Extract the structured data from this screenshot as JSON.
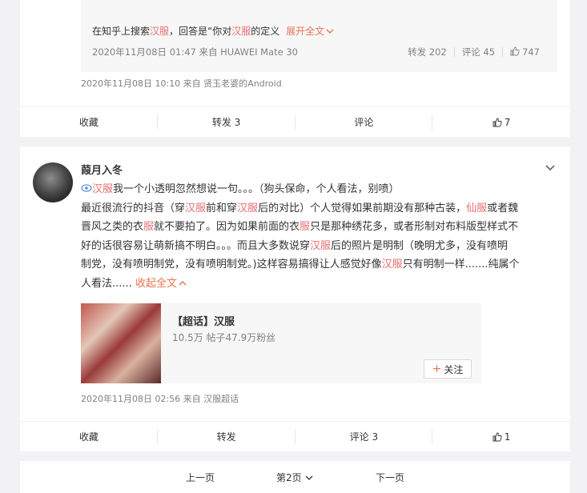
{
  "post1": {
    "quote": {
      "text_pre": "在知乎上搜索",
      "text_hl1": "汉服",
      "text_mid": "，回答是“你对",
      "text_hl2": "汉服",
      "text_post": "的定义",
      "expand": "展开全文",
      "meta": "2020年11月08日 01:47 来自 HUAWEI Mate 30",
      "repost": "转发 202",
      "comment": "评论 45",
      "likes": "747"
    },
    "meta": "2020年11月08日 10:10  来自 贤玉老婆的Android",
    "actions": {
      "collect": "收藏",
      "repost": "转发 3",
      "comment": "评论",
      "likes": "7"
    }
  },
  "post2": {
    "username": "葭月入冬",
    "lines": {
      "l1_hl": "汉服",
      "l1_rest": "我一个小透明忽然想说一句。。。（狗头保命，个人看法，别喷）",
      "l2_a": "最近很流行的抖音（穿",
      "l2_hl1": "汉服",
      "l2_b": "前和穿",
      "l2_hl2": "汉服",
      "l2_c": "后的对比）个人觉得如果前期没有那种古装，",
      "l2_hl3": "仙服",
      "l2_d": "或者魏",
      "l3_a": "晋风之类的衣",
      "l3_hl": "服",
      "l3_b": "就不要拍了。因为如果前面的衣",
      "l3_hl2": "服",
      "l3_c": "只是那种绣花多，或者形制对布料版型样式不",
      "l4": "好的话很容易让萌新搞不明白。。。而且大多数说穿",
      "l4_hl": "汉服",
      "l4_b": "后的照片是明制（晚明尤多，没有喷明",
      "l5_a": "制党，没有喷明制党，没有喷明制党。)这样容易搞得让人感觉好像",
      "l5_hl": "汉服",
      "l5_b": "只有明制一样.......纯属个",
      "l6": "人看法......",
      "collapse": "收起全文"
    },
    "topic_card": {
      "title": "【超话】汉服",
      "sub": "10.5万  帖子47.9万粉丝",
      "follow": "关注"
    },
    "meta": "2020年11月08日 02:56  来自 汉服超话",
    "actions": {
      "collect": "收藏",
      "repost": "转发",
      "comment": "评论 3",
      "likes": "1"
    }
  },
  "pager": {
    "prev": "上一页",
    "current": "第2页",
    "next": "下一页"
  },
  "colors": {
    "highlight": "#e66e6e",
    "link": "#eb7350",
    "muted": "#808080"
  }
}
